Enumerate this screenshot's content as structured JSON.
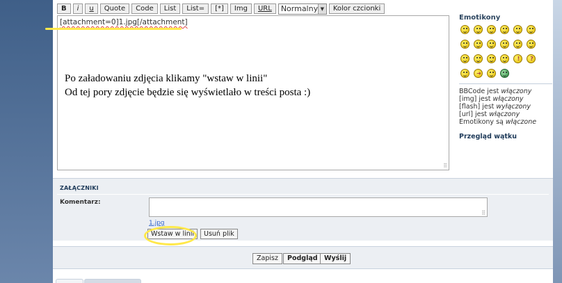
{
  "toolbar": {
    "bold": "B",
    "italic": "i",
    "underline": "u",
    "quote": "Quote",
    "code": "Code",
    "list": "List",
    "list_eq": "List=",
    "list_item": "[*]",
    "img": "Img",
    "url": "URL",
    "font_size_selected": "Normalny",
    "font_color": "Kolor czcionki"
  },
  "editor": {
    "content": "[attachment=0]1.jpg[/attachment]"
  },
  "annotation": {
    "line1": "Po załadowaniu zdjęcia klikamy \"wstaw w linii\"",
    "line2": "Od tej pory zdjęcie będzie się wyświetlało w treści posta :)"
  },
  "sidebar": {
    "emoticons_title": "Emotikony",
    "status": [
      {
        "label": "BBCode jest",
        "state": "włączony"
      },
      {
        "label": "[img] jest",
        "state": "włączony"
      },
      {
        "label": "[flash] jest",
        "state": "wyłączony"
      },
      {
        "label": "[url] jest",
        "state": "włączony"
      },
      {
        "label": "Emotikony są",
        "state": "włączone"
      }
    ],
    "topic_review": "Przegląd wątku"
  },
  "attachments": {
    "title": "ZAŁĄCZNIKI",
    "comment_label": "Komentarz:",
    "comment_value": "",
    "file_name": "1.jpg",
    "insert_inline": "Wstaw w linii",
    "delete_file": "Usuń plik"
  },
  "submit": {
    "save": "Zapisz",
    "preview": "Podgląd",
    "send": "Wyślij"
  },
  "colors": {
    "highlight": "#ffe84a",
    "frame_blue": "#4f6f97",
    "panel_bg": "#eceff3"
  }
}
